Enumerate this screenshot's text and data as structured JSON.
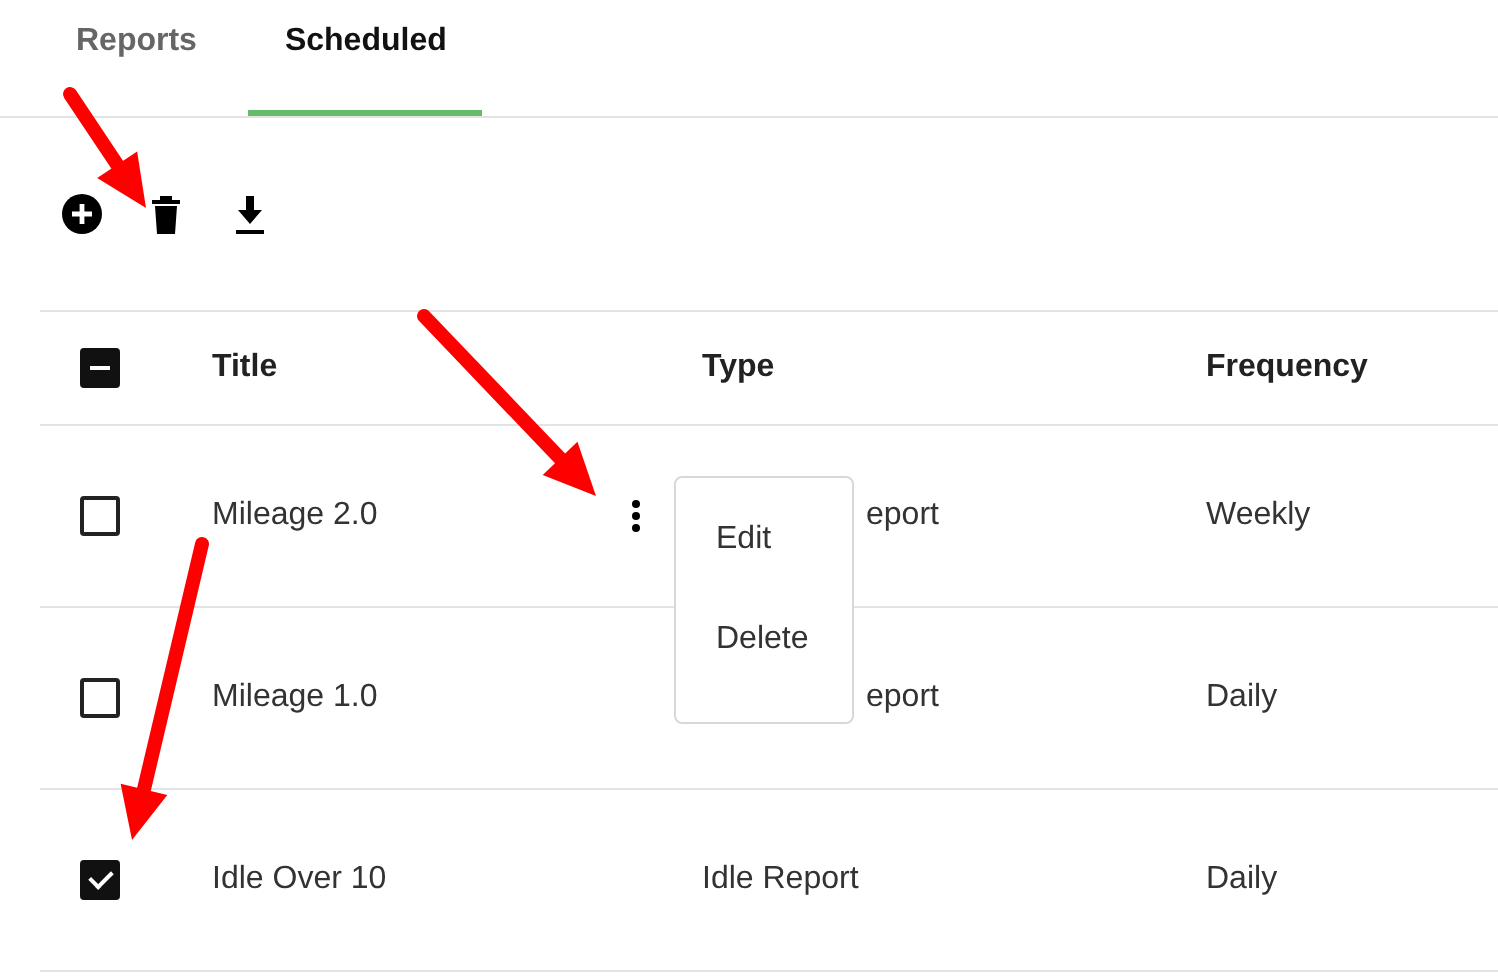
{
  "tabs": [
    {
      "label": "Reports",
      "selected": false
    },
    {
      "label": "Scheduled",
      "selected": true
    }
  ],
  "toolbar": [
    {
      "kind": "add"
    },
    {
      "kind": "delete"
    },
    {
      "kind": "download"
    }
  ],
  "table": {
    "header_checkbox": {
      "indeterminate": true
    },
    "columns": [
      "Title",
      "Type",
      "Frequency"
    ],
    "rows": [
      {
        "checked": false,
        "title": "Mileage 2.0",
        "type": "eport",
        "type_covered": true,
        "frequency": "Weekly",
        "actions_visible": true
      },
      {
        "checked": false,
        "title": "Mileage 1.0",
        "type": "eport",
        "type_covered": true,
        "frequency": "Daily",
        "actions_visible": false
      },
      {
        "checked": true,
        "title": "Idle Over 10",
        "type": "Idle Report",
        "type_covered": false,
        "frequency": "Daily",
        "actions_visible": false
      }
    ]
  },
  "row_menu": {
    "items": [
      "Edit",
      "Delete"
    ]
  },
  "annotations": [
    {
      "kind": "arrow"
    },
    {
      "kind": "arrow"
    },
    {
      "kind": "arrow"
    }
  ]
}
